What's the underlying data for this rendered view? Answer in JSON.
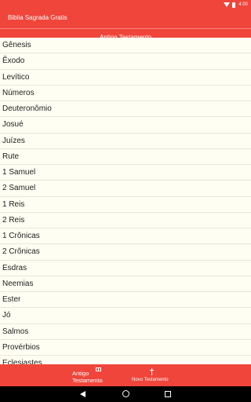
{
  "status_bar": {
    "time": "4:00"
  },
  "app_bar": {
    "title": "Biblia Sagrada Gratis"
  },
  "section": {
    "title": "Antigo Testamento"
  },
  "books": [
    "Gênesis",
    "Êxodo",
    "Levítico",
    "Números",
    "Deuteronômio",
    "Josué",
    "Juízes",
    "Rute",
    "1 Samuel",
    "2 Samuel",
    "1 Reis",
    "2 Reis",
    "1 Crônicas",
    "2 Crônicas",
    "Esdras",
    "Neemias",
    "Ester",
    "Jó",
    "Salmos",
    "Provérbios",
    "Eclesiastes"
  ],
  "bottom_nav": {
    "old_testament_label": "Antigo Testamento",
    "new_testament_label": "Novo Testamento"
  },
  "colors": {
    "accent": "#f0453a",
    "background": "#fffef2"
  }
}
